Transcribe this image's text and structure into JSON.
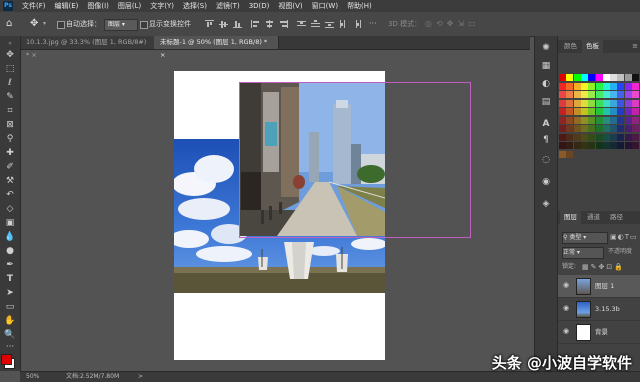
{
  "menubar": {
    "logo": "Ps",
    "menus": [
      "文件(F)",
      "编辑(E)",
      "图像(I)",
      "图层(L)",
      "文字(Y)",
      "选择(S)",
      "滤镜(T)",
      "3D(D)",
      "视图(V)",
      "窗口(W)",
      "帮助(H)"
    ]
  },
  "options": {
    "auto_select_label": "自动选择：",
    "auto_select_value": "图层",
    "show_transform_label": "显示变换控件",
    "mode3d_label": "3D 模式："
  },
  "tabs": [
    {
      "label": "10.1.3.jpg @ 33.3% (图层 1, RGB/8#) *",
      "close": "×"
    },
    {
      "label": "未标题-1 @ 50% (图层 1, RGB/8) *",
      "close": "×"
    }
  ],
  "status": {
    "zoom": "50%",
    "doc": "文档:2.52M/7.80M",
    "arrow": ">"
  },
  "swatches_panel": {
    "tab_color": "颜色",
    "tab_swatches": "色板"
  },
  "layers_panel": {
    "tabs": [
      "图层",
      "通道",
      "路径"
    ],
    "filter_label": "类型",
    "blend_mode": "正常",
    "opacity_label": "不透明度",
    "lock_label": "锁定:",
    "layers": [
      {
        "name": "图层 1",
        "selected": true
      },
      {
        "name": "3.15.3b",
        "selected": false
      },
      {
        "name": "背景",
        "selected": false
      }
    ]
  },
  "watermark": "头条 @小波自学软件",
  "colors": {
    "swatch_row1": [
      "#e00000",
      "#ffff00",
      "#00ff00",
      "#00ffff",
      "#0000ff",
      "#ff00ff",
      "#ffffff",
      "#e0e0e0",
      "#c0c0c0",
      "#9a9a9a",
      "#111111"
    ],
    "accent_frame": "#c05ec0",
    "fg_color": "#e00000",
    "bg_color": "#ffffff"
  }
}
